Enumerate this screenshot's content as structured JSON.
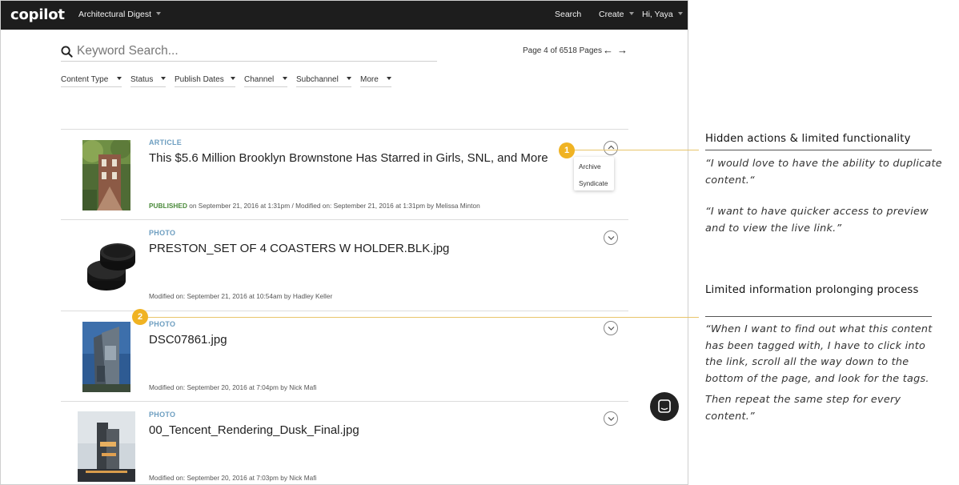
{
  "header": {
    "logo": "copilot",
    "brand_menu": "Architectural Digest",
    "search": "Search",
    "create": "Create",
    "greeting": "Hi, Yaya"
  },
  "search": {
    "placeholder": "Keyword Search..."
  },
  "pagination": {
    "text": "Page 4 of 6518 Pages",
    "prev": "←",
    "next": "→"
  },
  "filters": [
    "Content Type",
    "Status",
    "Publish Dates",
    "Channel",
    "Subchannel",
    "More"
  ],
  "items": [
    {
      "type": "ARTICLE",
      "title": "This $5.6 Million Brooklyn Brownstone Has Starred in Girls, SNL, and More",
      "status": "PUBLISHED",
      "meta": " on September 21, 2016 at 1:31pm  /  Modified on: September 21, 2016 at 1:31pm by Melissa Minton",
      "menu_open": true
    },
    {
      "type": "PHOTO",
      "title": "PRESTON_SET OF 4 COASTERS W HOLDER.BLK.jpg",
      "meta": "Modified on: September 21, 2016 at 10:54am by Hadley Keller"
    },
    {
      "type": "PHOTO",
      "title": "DSC07861.jpg",
      "meta": "Modified on: September 20, 2016 at 7:04pm by Nick Mafi"
    },
    {
      "type": "PHOTO",
      "title": "00_Tencent_Rendering_Dusk_Final.jpg",
      "meta": "Modified on: September 20, 2016 at 7:03pm by Nick Mafi"
    }
  ],
  "action_menu": [
    "Archive",
    "Syndicate"
  ],
  "annotations": [
    {
      "number": "1",
      "title": "Hidden actions & limited functionality",
      "quotes": [
        "“I would love to have the ability to duplicate content.“",
        "“I want to have quicker access to preview and to view the live link.”"
      ]
    },
    {
      "number": "2",
      "title": "Limited information prolonging process",
      "quotes": [
        "“When I want to find out what this content has been tagged with, I have to click into the link, scroll all the way down to the bottom of the page, and look for the tags.",
        "Then repeat the same step for every content.”"
      ]
    }
  ],
  "colors": {
    "topbar": "#1d1d1d",
    "content_type": "#6d9ec0",
    "published": "#4a8a3a",
    "annotation_badge": "#f0b323"
  }
}
